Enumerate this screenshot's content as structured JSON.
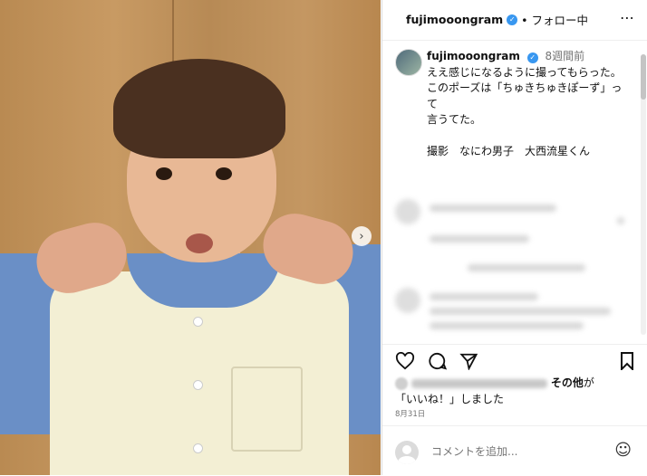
{
  "post": {
    "username": "fujimooongram",
    "follow_text": "• フォロー中",
    "more_icon": "⋯",
    "next_icon": "›"
  },
  "caption": {
    "username": "fujimooongram",
    "time": "8週間前",
    "text": "ええ感じになるように撮ってもらった。\nこのポーズは「ちゅきちゅきぽーず」って\n言うてた。\n\n撮影　なにわ男子　大西流星くん"
  },
  "likes": {
    "others_label": "その他",
    "suffix": "が「いいね！」しました"
  },
  "date": "8月31日",
  "comment": {
    "placeholder": "コメントを追加..."
  }
}
